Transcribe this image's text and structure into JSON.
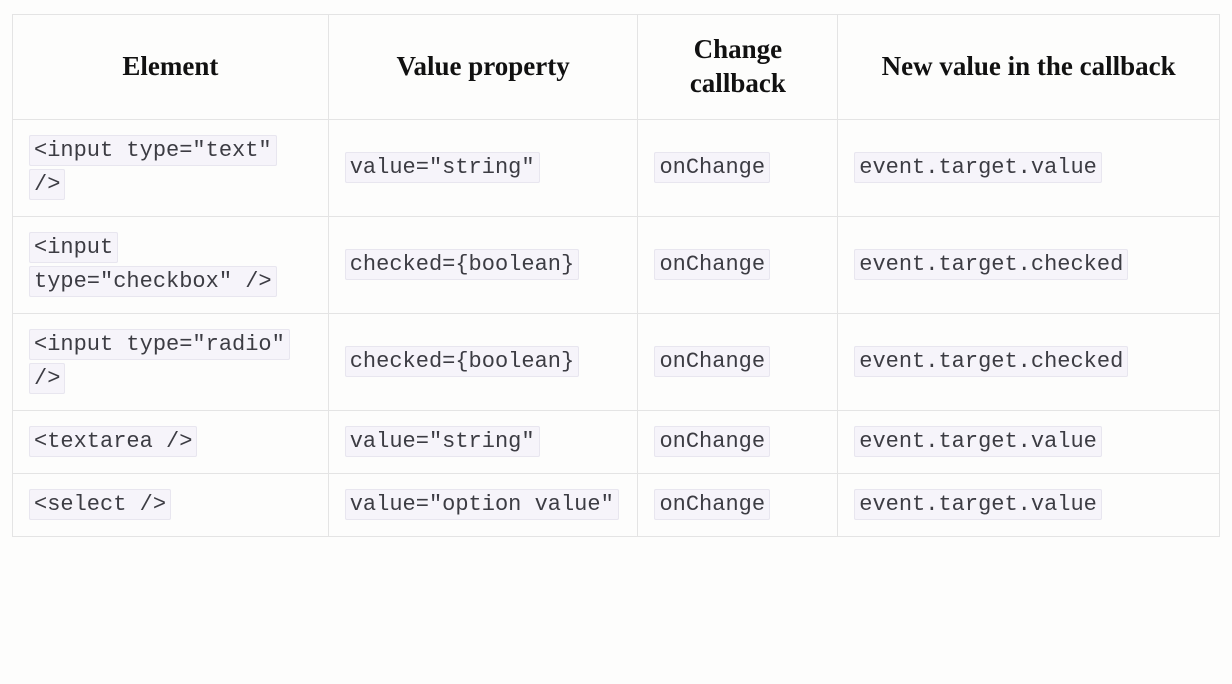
{
  "table": {
    "headers": {
      "element": "Element",
      "value_property": "Value property",
      "change_callback": "Change callback",
      "new_value": "New value in the callback"
    },
    "rows": [
      {
        "element": "<input type=\"text\" />",
        "value_property": "value=\"string\"",
        "change_callback": "onChange",
        "new_value": "event.target.value"
      },
      {
        "element": "<input type=\"checkbox\" />",
        "value_property": "checked={boolean}",
        "change_callback": "onChange",
        "new_value": "event.target.checked"
      },
      {
        "element": "<input type=\"radio\" />",
        "value_property": "checked={boolean}",
        "change_callback": "onChange",
        "new_value": "event.target.checked"
      },
      {
        "element": "<textarea />",
        "value_property": "value=\"string\"",
        "change_callback": "onChange",
        "new_value": "event.target.value"
      },
      {
        "element": "<select />",
        "value_property": "value=\"option value\"",
        "change_callback": "onChange",
        "new_value": "event.target.value"
      }
    ]
  }
}
